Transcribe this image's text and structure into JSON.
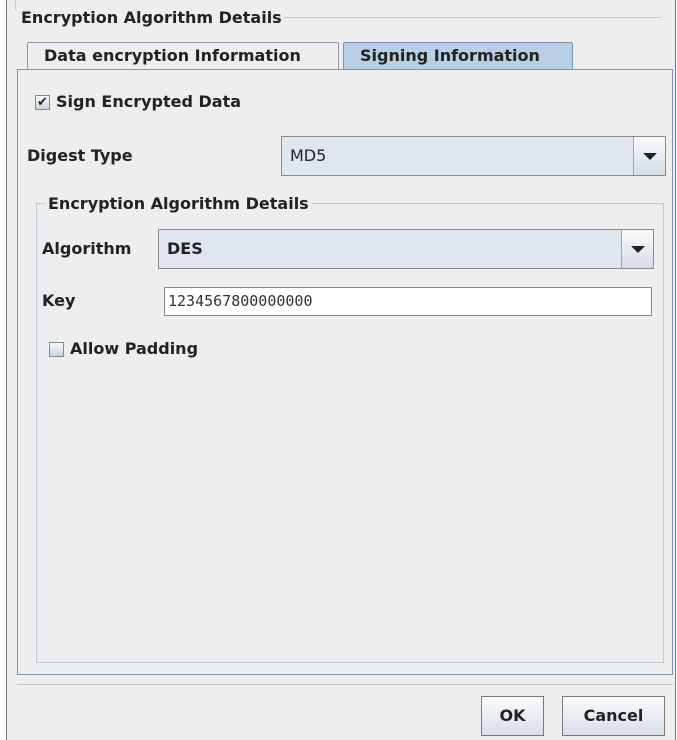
{
  "dialog": {
    "title": "Encryption Algorithm Details",
    "tabs": [
      {
        "label": "Data encryption Information",
        "selected": false
      },
      {
        "label": "Signing Information",
        "selected": true
      }
    ]
  },
  "signing": {
    "sign_encrypted_data_label": "Sign Encrypted Data",
    "sign_encrypted_data_checked": true,
    "check_glyph": "✔",
    "digest_type_label": "Digest Type",
    "digest_type_value": "MD5"
  },
  "encryption_group": {
    "title": "Encryption Algorithm Details",
    "algorithm_label": "Algorithm",
    "algorithm_value": "DES",
    "key_label": "Key",
    "key_value": "1234567800000000",
    "allow_padding_label": "Allow Padding",
    "allow_padding_checked": false
  },
  "footer": {
    "ok_label": "OK",
    "cancel_label": "Cancel"
  },
  "colors": {
    "selected_tab": "#b8cfe5",
    "panel_border": "#7f94b8",
    "combo_bg": "#dfe6ef",
    "dialog_bg": "#eeeeee"
  }
}
